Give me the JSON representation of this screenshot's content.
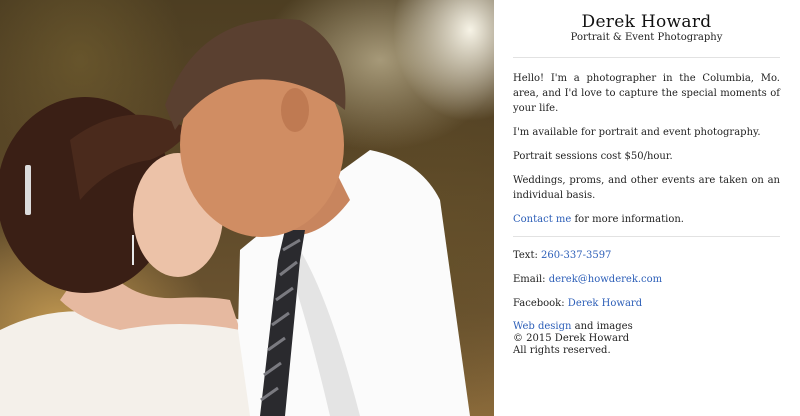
{
  "site": {
    "name": "Derek Howard",
    "tagline": "Portrait & Event Photography"
  },
  "intro": {
    "p1": "Hello! I'm a photographer in the Columbia, Mo. area, and I'd love to capture the special moments of your life.",
    "p2": "I'm available for portrait and event photography.",
    "p3": "Portrait sessions cost $50/hour.",
    "p4": "Weddings, proms, and other events are taken on an individual basis.",
    "contact_link": "Contact me",
    "contact_suffix": " for more information."
  },
  "contact": {
    "text_label": "Text: ",
    "text_value": "260-337-3597",
    "email_label": "Email: ",
    "email_value": "derek@howderek.com",
    "facebook_label": "Facebook: ",
    "facebook_value": "Derek Howard"
  },
  "footer": {
    "web_design_link": "Web design",
    "web_design_suffix": " and images",
    "copyright": "© 2015 Derek Howard",
    "rights": "All rights reserved."
  },
  "colors": {
    "link": "#2d5fb8",
    "divider": "#e2e2e2"
  },
  "hero_image": {
    "subject": "couple embracing, foreheads touching, outdoor trees background"
  }
}
